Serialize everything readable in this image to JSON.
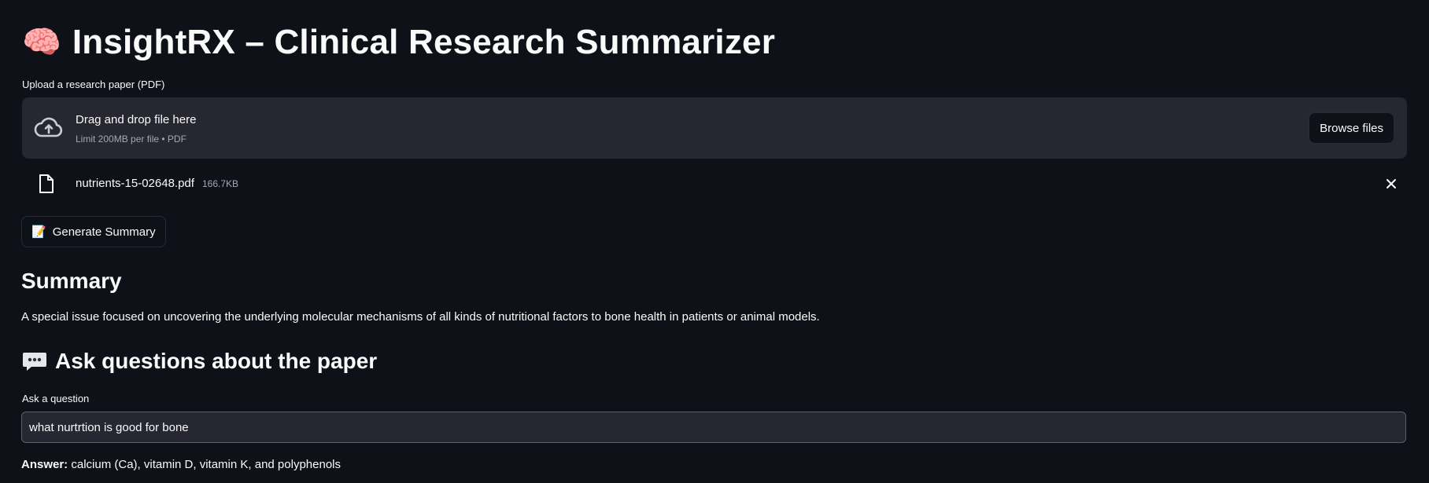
{
  "header": {
    "emoji": "🧠",
    "title": "InsightRX – Clinical Research Summarizer"
  },
  "uploader": {
    "label": "Upload a research paper (PDF)",
    "drop_title": "Drag and drop file here",
    "drop_subtitle": "Limit 200MB per file • PDF",
    "browse_label": "Browse files",
    "file": {
      "name": "nutrients-15-02648.pdf",
      "size": "166.7KB"
    }
  },
  "generate": {
    "emoji": "📝",
    "label": "Generate Summary"
  },
  "summary": {
    "heading": "Summary",
    "text": "A special issue focused on uncovering the underlying molecular mechanisms of all kinds of nutritional factors to bone health in patients or animal models."
  },
  "questions": {
    "heading": "Ask questions about the paper",
    "input_label": "Ask a question",
    "input_value": "what nurtrtion is good for bone",
    "answer_prefix": "Answer:",
    "answer_text": "calcium (Ca), vitamin D, vitamin K, and polyphenols"
  },
  "colors": {
    "background": "#0e1117",
    "surface": "#262730",
    "text": "#fafafa",
    "muted": "#a3a8b4"
  }
}
